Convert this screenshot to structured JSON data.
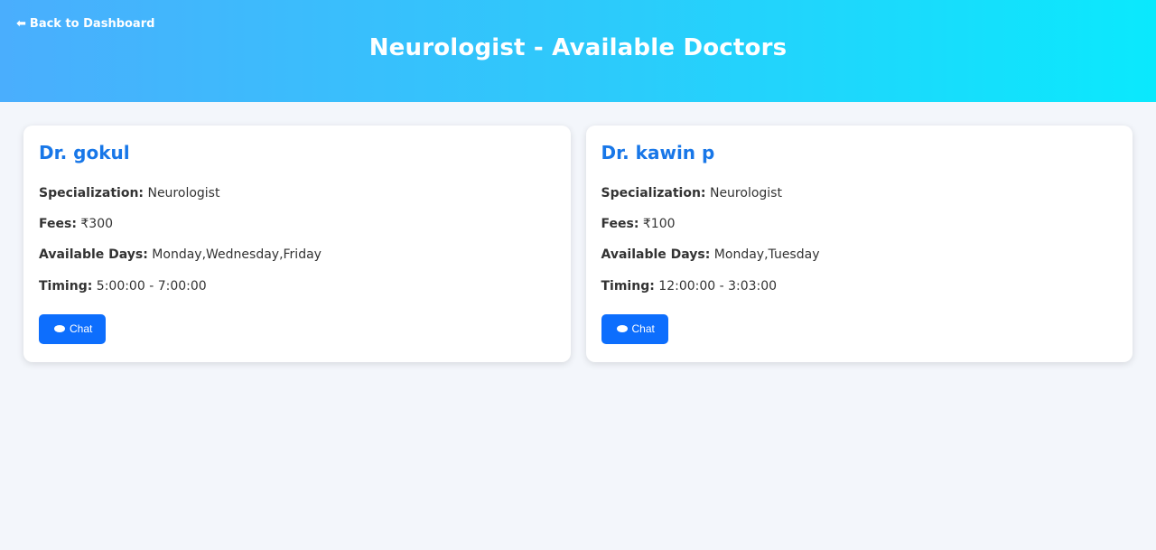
{
  "header": {
    "back_label": "Back to Dashboard",
    "back_icon": "arrow-left-icon",
    "title": "Neurologist - Available Doctors"
  },
  "labels": {
    "specialization": "Specialization:",
    "fees": "Fees:",
    "available_days": "Available Days:",
    "timing": "Timing:",
    "chat": "Chat"
  },
  "doctors": [
    {
      "name": "Dr. gokul",
      "specialization": "Neurologist",
      "fees": "₹300",
      "available_days": "Monday,Wednesday,Friday",
      "timing": "5:00:00 - 7:00:00"
    },
    {
      "name": "Dr. kawin p",
      "specialization": "Neurologist",
      "fees": "₹100",
      "available_days": "Monday,Tuesday",
      "timing": "12:00:00 - 3:03:00"
    }
  ],
  "colors": {
    "header_gradient_start": "#4aaefd",
    "header_gradient_end": "#0ae9fd",
    "doctor_name": "#1877e8",
    "chat_button": "#0d6efd",
    "page_background": "#f3f6fb"
  }
}
